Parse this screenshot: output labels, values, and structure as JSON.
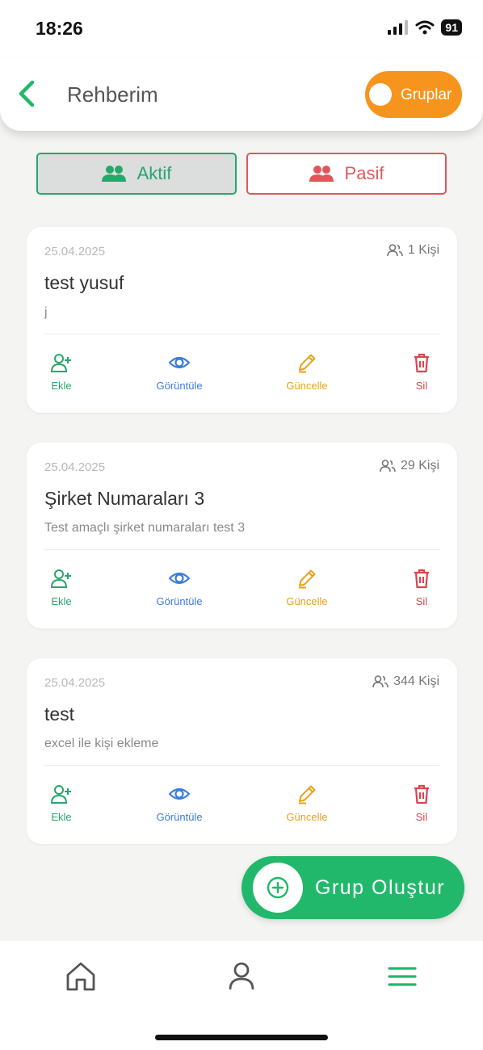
{
  "status_bar": {
    "time": "18:26",
    "battery": "91"
  },
  "header": {
    "title": "Rehberim",
    "groups_label": "Gruplar"
  },
  "filters": {
    "active_label": "Aktif",
    "passive_label": "Pasif"
  },
  "groups": [
    {
      "date": "25.04.2025",
      "count": "1 Kişi",
      "title": "test yusuf",
      "description": "j"
    },
    {
      "date": "25.04.2025",
      "count": "29 Kişi",
      "title": "Şirket Numaraları 3",
      "description": "Test amaçlı şirket numaraları test 3"
    },
    {
      "date": "25.04.2025",
      "count": "344 Kişi",
      "title": "test",
      "description": "excel ile kişi ekleme"
    }
  ],
  "actions": {
    "add": "Ekle",
    "view": "Görüntüle",
    "edit": "Güncelle",
    "delete": "Sil"
  },
  "fab": {
    "label": "Grup Oluştur"
  },
  "bottom_nav": {
    "items": [
      "home-icon",
      "profile-icon",
      "menu-icon"
    ],
    "active": "menu-icon"
  },
  "colors": {
    "accent_green": "#22b86b",
    "orange": "#f7941d",
    "red": "#d9454c",
    "blue": "#3b7ddd",
    "yellow": "#e8a21b"
  }
}
